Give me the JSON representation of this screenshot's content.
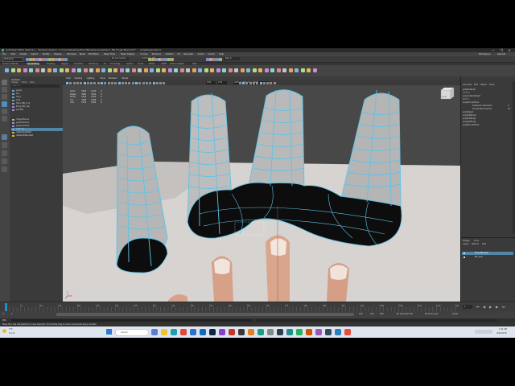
{
  "window": {
    "title": "Autodesk MAYA 2024.2.1 - Student Version: C:\\Users\\Desktop\\HandModel\\scenes\\Hand_BR_FingerMesh.mb* --- polyManipulator1",
    "controls": [
      "—",
      "❐",
      "✕"
    ]
  },
  "menubar": {
    "items": [
      "File",
      "Edit",
      "Create",
      "Select",
      "Modify",
      "Display",
      "Windows",
      "Mesh",
      "Edit Mesh",
      "Mesh Tools",
      "Mesh Display",
      "Curves",
      "Surfaces",
      "Deform",
      "UV",
      "Generate",
      "Cache",
      "Arnold",
      "Help"
    ],
    "right": [
      "Workspace:",
      "General"
    ]
  },
  "statusline": {
    "mode": "Modeling",
    "live": "No Live Surface",
    "symmetry": "Symmetry: Off",
    "sign_in": "Sign In"
  },
  "shelf": {
    "tabs": [
      "Curves / Surfaces",
      "Poly Modeling",
      "Sculpting",
      "Rigging",
      "Animation",
      "Rendering",
      "FX",
      "FX Caching",
      "Custom",
      "Arnold",
      "Bifrost",
      "MASH",
      "Motion Graphics",
      "XGen"
    ],
    "active_index": 1
  },
  "outliner": {
    "title": "Outliner",
    "menu": [
      "Display",
      "Show",
      "Help"
    ],
    "search_placeholder": "Search...",
    "items": [
      "persp",
      "top",
      "front",
      "side",
      "Hand_BR_Imp",
      "Body_BR_Imp",
      "pCube1",
      "imagePlane1",
      "polySurface1",
      "polySurface2",
      "pPlane1",
      "defaultLightSet",
      "defaultObjectSet"
    ],
    "selected_index": 10
  },
  "viewport": {
    "menu": [
      "View",
      "Shading",
      "Lighting",
      "Show",
      "Renderer",
      "Panels"
    ],
    "hud": {
      "rows": [
        {
          "label": "Verts:",
          "a": "1840",
          "b": "1520",
          "c": "0"
        },
        {
          "label": "Edges:",
          "a": "3660",
          "b": "3024",
          "c": "0"
        },
        {
          "label": "Faces:",
          "a": "1824",
          "b": "1504",
          "c": "0"
        },
        {
          "label": "Tris:",
          "a": "3648",
          "b": "3008",
          "c": "0"
        },
        {
          "label": "UVs:",
          "a": "1976",
          "b": "1624",
          "c": "0"
        }
      ]
    },
    "camera_fields": [
      "0.00",
      "1.00"
    ],
    "color_space": "ACES 1.0 SDR-video (sRGB)",
    "viewcube": "FRONT"
  },
  "channelbox": {
    "tabs": [
      "Channels",
      "Edit",
      "Object",
      "Show"
    ],
    "object": "polySurface2",
    "shapes_label": "SHAPES",
    "shape": "polySurfaceShape2",
    "inputs_label": "INPUTS",
    "inputs": [
      "polyExtrudeFace1",
      "polyTweak1"
    ],
    "attrs": [
      {
        "name": "Subdivision Resolution",
        "value": "2"
      },
      {
        "name": "Smooth Mesh Preview",
        "value": "off"
      }
    ],
    "outputs": [
      "polySplitRing3",
      "polySplitRing2",
      "polySplitRing1",
      "polyExtrudeFace2"
    ]
  },
  "layers": {
    "tabs": [
      "Display",
      "Anim"
    ],
    "menu": [
      "Layers",
      "Options",
      "Help"
    ],
    "items": [
      {
        "name": "Body_BR_layer",
        "selected": true
      },
      {
        "name": "BR_layer",
        "selected": false
      }
    ]
  },
  "timeslider": {
    "ticks": [
      "1",
      "5",
      "10",
      "15",
      "20",
      "25",
      "30",
      "35",
      "40",
      "45",
      "50",
      "55",
      "60",
      "65",
      "70",
      "75",
      "80",
      "85",
      "90",
      "95",
      "100",
      "105",
      "110",
      "115",
      "120"
    ],
    "current_frame": "1"
  },
  "rangeslider": {
    "start": "1",
    "start2": "1",
    "end": "120",
    "end2": "120",
    "end3": "200",
    "fps": "24 fps",
    "char_set": "No Character Set",
    "anim_layer": "No Anim Layer"
  },
  "cmdline": {
    "label": "MEL"
  },
  "helpline": {
    "text": "Move Tool: Use manipulator to move object(s). Ctrl+middle-drag to move components along normals."
  },
  "taskbar": {
    "weather_temp": "3°C",
    "weather_desc": "Cloudy",
    "search": "Search",
    "time": "1:41 AM",
    "date": "2024-02-05",
    "lang": "ENG"
  },
  "colors": {
    "accent": "#5aa9d6",
    "selected_row": "#5285a6",
    "viewport_bg": "#484848",
    "mesh_fill": "#b9b9b9",
    "wire": "#5fc3e6"
  }
}
